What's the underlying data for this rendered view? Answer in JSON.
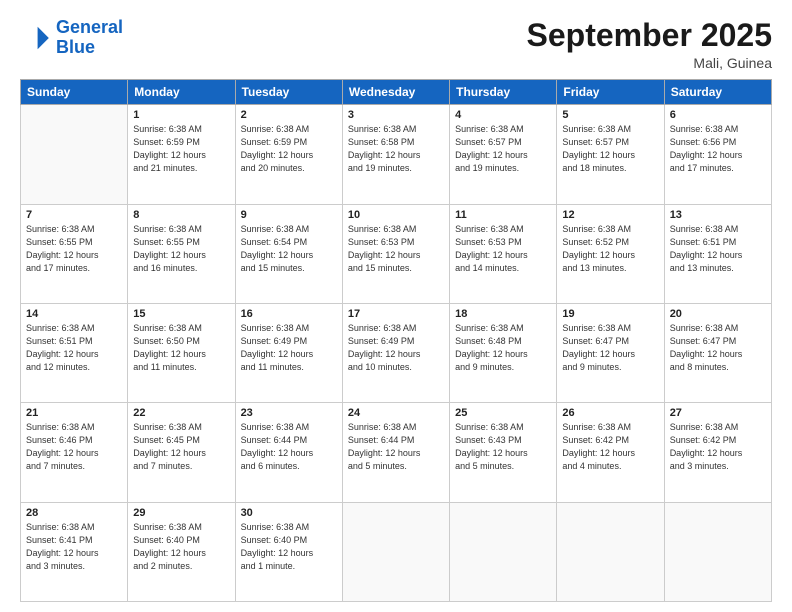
{
  "header": {
    "logo_line1": "General",
    "logo_line2": "Blue",
    "main_title": "September 2025",
    "subtitle": "Mali, Guinea"
  },
  "weekdays": [
    "Sunday",
    "Monday",
    "Tuesday",
    "Wednesday",
    "Thursday",
    "Friday",
    "Saturday"
  ],
  "weeks": [
    [
      {
        "day": "",
        "info": ""
      },
      {
        "day": "1",
        "info": "Sunrise: 6:38 AM\nSunset: 6:59 PM\nDaylight: 12 hours\nand 21 minutes."
      },
      {
        "day": "2",
        "info": "Sunrise: 6:38 AM\nSunset: 6:59 PM\nDaylight: 12 hours\nand 20 minutes."
      },
      {
        "day": "3",
        "info": "Sunrise: 6:38 AM\nSunset: 6:58 PM\nDaylight: 12 hours\nand 19 minutes."
      },
      {
        "day": "4",
        "info": "Sunrise: 6:38 AM\nSunset: 6:57 PM\nDaylight: 12 hours\nand 19 minutes."
      },
      {
        "day": "5",
        "info": "Sunrise: 6:38 AM\nSunset: 6:57 PM\nDaylight: 12 hours\nand 18 minutes."
      },
      {
        "day": "6",
        "info": "Sunrise: 6:38 AM\nSunset: 6:56 PM\nDaylight: 12 hours\nand 17 minutes."
      }
    ],
    [
      {
        "day": "7",
        "info": "Sunrise: 6:38 AM\nSunset: 6:55 PM\nDaylight: 12 hours\nand 17 minutes."
      },
      {
        "day": "8",
        "info": "Sunrise: 6:38 AM\nSunset: 6:55 PM\nDaylight: 12 hours\nand 16 minutes."
      },
      {
        "day": "9",
        "info": "Sunrise: 6:38 AM\nSunset: 6:54 PM\nDaylight: 12 hours\nand 15 minutes."
      },
      {
        "day": "10",
        "info": "Sunrise: 6:38 AM\nSunset: 6:53 PM\nDaylight: 12 hours\nand 15 minutes."
      },
      {
        "day": "11",
        "info": "Sunrise: 6:38 AM\nSunset: 6:53 PM\nDaylight: 12 hours\nand 14 minutes."
      },
      {
        "day": "12",
        "info": "Sunrise: 6:38 AM\nSunset: 6:52 PM\nDaylight: 12 hours\nand 13 minutes."
      },
      {
        "day": "13",
        "info": "Sunrise: 6:38 AM\nSunset: 6:51 PM\nDaylight: 12 hours\nand 13 minutes."
      }
    ],
    [
      {
        "day": "14",
        "info": "Sunrise: 6:38 AM\nSunset: 6:51 PM\nDaylight: 12 hours\nand 12 minutes."
      },
      {
        "day": "15",
        "info": "Sunrise: 6:38 AM\nSunset: 6:50 PM\nDaylight: 12 hours\nand 11 minutes."
      },
      {
        "day": "16",
        "info": "Sunrise: 6:38 AM\nSunset: 6:49 PM\nDaylight: 12 hours\nand 11 minutes."
      },
      {
        "day": "17",
        "info": "Sunrise: 6:38 AM\nSunset: 6:49 PM\nDaylight: 12 hours\nand 10 minutes."
      },
      {
        "day": "18",
        "info": "Sunrise: 6:38 AM\nSunset: 6:48 PM\nDaylight: 12 hours\nand 9 minutes."
      },
      {
        "day": "19",
        "info": "Sunrise: 6:38 AM\nSunset: 6:47 PM\nDaylight: 12 hours\nand 9 minutes."
      },
      {
        "day": "20",
        "info": "Sunrise: 6:38 AM\nSunset: 6:47 PM\nDaylight: 12 hours\nand 8 minutes."
      }
    ],
    [
      {
        "day": "21",
        "info": "Sunrise: 6:38 AM\nSunset: 6:46 PM\nDaylight: 12 hours\nand 7 minutes."
      },
      {
        "day": "22",
        "info": "Sunrise: 6:38 AM\nSunset: 6:45 PM\nDaylight: 12 hours\nand 7 minutes."
      },
      {
        "day": "23",
        "info": "Sunrise: 6:38 AM\nSunset: 6:44 PM\nDaylight: 12 hours\nand 6 minutes."
      },
      {
        "day": "24",
        "info": "Sunrise: 6:38 AM\nSunset: 6:44 PM\nDaylight: 12 hours\nand 5 minutes."
      },
      {
        "day": "25",
        "info": "Sunrise: 6:38 AM\nSunset: 6:43 PM\nDaylight: 12 hours\nand 5 minutes."
      },
      {
        "day": "26",
        "info": "Sunrise: 6:38 AM\nSunset: 6:42 PM\nDaylight: 12 hours\nand 4 minutes."
      },
      {
        "day": "27",
        "info": "Sunrise: 6:38 AM\nSunset: 6:42 PM\nDaylight: 12 hours\nand 3 minutes."
      }
    ],
    [
      {
        "day": "28",
        "info": "Sunrise: 6:38 AM\nSunset: 6:41 PM\nDaylight: 12 hours\nand 3 minutes."
      },
      {
        "day": "29",
        "info": "Sunrise: 6:38 AM\nSunset: 6:40 PM\nDaylight: 12 hours\nand 2 minutes."
      },
      {
        "day": "30",
        "info": "Sunrise: 6:38 AM\nSunset: 6:40 PM\nDaylight: 12 hours\nand 1 minute."
      },
      {
        "day": "",
        "info": ""
      },
      {
        "day": "",
        "info": ""
      },
      {
        "day": "",
        "info": ""
      },
      {
        "day": "",
        "info": ""
      }
    ]
  ]
}
